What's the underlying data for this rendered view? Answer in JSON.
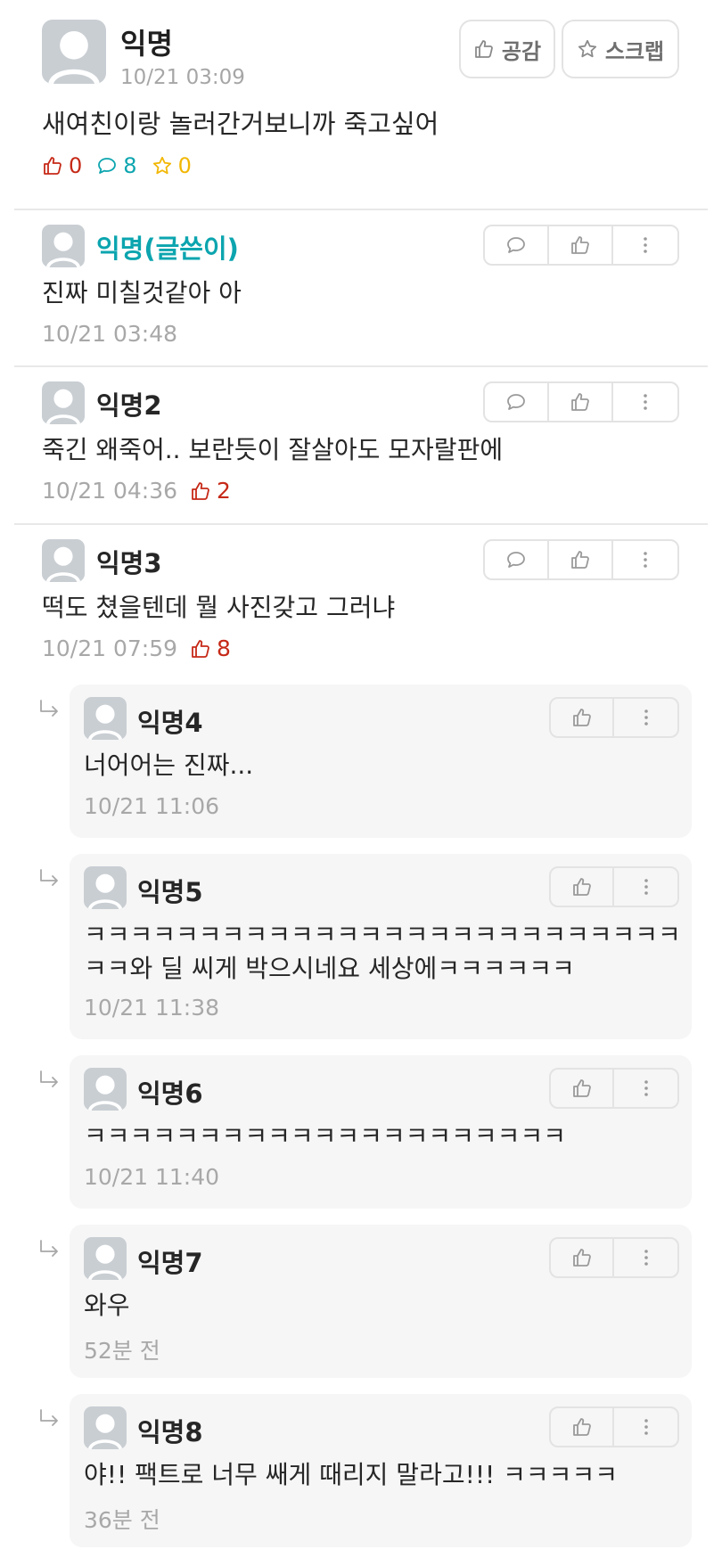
{
  "article": {
    "author": "익명",
    "time": "10/21 03:09",
    "body": "새여친이랑 놀러간거보니까 죽고싶어",
    "likes": "0",
    "comments": "8",
    "scraps": "0",
    "like_button": "공감",
    "scrap_button": "스크랩"
  },
  "comments": [
    {
      "author": "익명(글쓴이)",
      "body": "진짜 미칠것같아 아",
      "time": "10/21 03:48",
      "likes": ""
    },
    {
      "author": "익명2",
      "body": "죽긴 왜죽어.. 보란듯이 잘살아도 모자랄판에",
      "time": "10/21 04:36",
      "likes": "2"
    },
    {
      "author": "익명3",
      "body": "떡도 쳤을텐데 뭘 사진갖고 그러냐",
      "time": "10/21 07:59",
      "likes": "8"
    }
  ],
  "replies": [
    {
      "author": "익명4",
      "body": "너어어는 진짜...",
      "time": "10/21 11:06"
    },
    {
      "author": "익명5",
      "body_line1": "ㅋㅋㅋㅋㅋㅋㅋㅋㅋㅋㅋㅋㅋㅋㅋㅋㅋㅋㅋㅋㅋㅋㅋㅋㅋㅋ",
      "body_line2": "ㅋㅋ와 딜 씨게 박으시네요 세상에ㅋㅋㅋㅋㅋㅋ",
      "time": "10/21 11:38"
    },
    {
      "author": "익명6",
      "body": "ㅋㅋㅋㅋㅋㅋㅋㅋㅋㅋㅋㅋㅋㅋㅋㅋㅋㅋㅋㅋㅋ",
      "time": "10/21 11:40"
    },
    {
      "author": "익명7",
      "body": "와우",
      "time": "52분 전"
    },
    {
      "author": "익명8",
      "body": "야!! 팩트로 너무 쌔게 때리지 말라고!!! ㅋㅋㅋㅋㅋ",
      "time": "36분 전"
    }
  ],
  "icons": {
    "like": "thumbs-up-icon",
    "comment": "speech-bubble-icon",
    "scrap": "star-icon",
    "more": "vertical-dots-icon",
    "reply": "reply-arrow-icon",
    "avatar": "default-avatar"
  },
  "colors": {
    "like": "#c62917",
    "comment": "#0ca5af",
    "scrap": "#f2b705",
    "op_author": "#0ca5af",
    "muted": "#a8a8a8",
    "reply_bg": "#f6f6f6"
  }
}
